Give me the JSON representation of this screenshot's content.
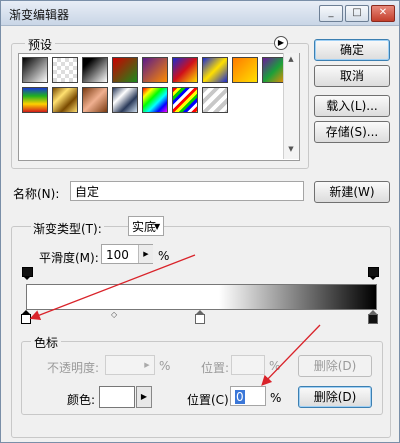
{
  "window": {
    "title": "渐变编辑器",
    "minimize_glyph": "_",
    "restore_glyph": "□",
    "close_glyph": "✕"
  },
  "presets": {
    "label": "预设",
    "swatches": [
      {
        "name": "black-white"
      },
      {
        "name": "transparent-1"
      },
      {
        "name": "black-white-2"
      },
      {
        "name": "red-green"
      },
      {
        "name": "violet-orange"
      },
      {
        "name": "blue-red-yellow"
      },
      {
        "name": "blue-yellow-blue"
      },
      {
        "name": "orange-yellow"
      },
      {
        "name": "violet-green-orange"
      },
      {
        "name": "rainbow-vertical"
      },
      {
        "name": "gold-stripes"
      },
      {
        "name": "copper"
      },
      {
        "name": "chrome"
      },
      {
        "name": "spectrum"
      },
      {
        "name": "transparent-rainbow"
      },
      {
        "name": "transparent-stripes"
      }
    ]
  },
  "buttons": {
    "ok": "确定",
    "cancel": "取消",
    "load": "载入(L)...",
    "save": "存储(S)...",
    "new": "新建(W)"
  },
  "name": {
    "label": "名称(N):",
    "value": "自定"
  },
  "gradient_type": {
    "label": "渐变类型(T):",
    "value": "实底"
  },
  "smoothness": {
    "label": "平滑度(M):",
    "value": "100",
    "unit": "%"
  },
  "color_stops": {
    "label": "色标",
    "opacity_label": "不透明度:",
    "opacity_unit": "%",
    "opacity_location_label": "位置:",
    "opacity_location_unit": "%",
    "delete_disabled": "删除(D)",
    "color_label": "颜色:",
    "location_label": "位置(C):",
    "location_value": "0",
    "location_unit": "%",
    "delete": "删除(D)"
  },
  "colors": {
    "accent": "#3c7fb1",
    "annotation_arrow": "#d9232a"
  }
}
